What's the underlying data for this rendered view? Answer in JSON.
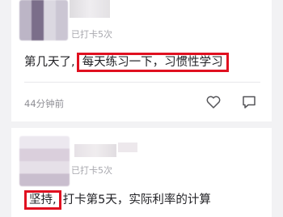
{
  "posts": [
    {
      "checkin_text": "已打卡5次",
      "content_before": "第几天了,",
      "content_highlight": "每天练习一下，习惯性学习",
      "timestamp": "44分钟前"
    },
    {
      "checkin_text": "已打卡5次",
      "content_highlight": "坚持,",
      "content_after": "打卡第5天，实际利率的计算"
    }
  ],
  "colors": {
    "highlight_border": "#e01020",
    "background": "#f2f2f4"
  },
  "icons": [
    "heart-icon",
    "comment-icon"
  ]
}
